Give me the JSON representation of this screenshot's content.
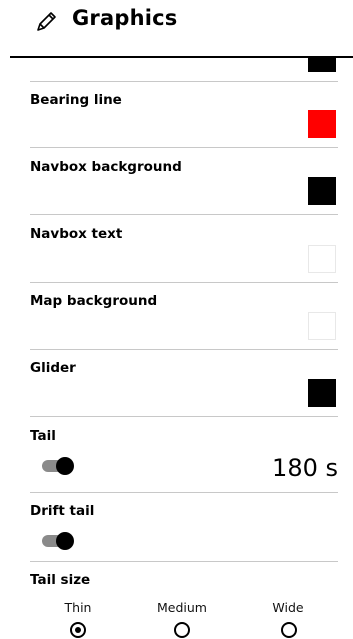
{
  "header": {
    "title": "Graphics",
    "icon": "pencil-icon"
  },
  "settings": {
    "bearing_line": {
      "label": "Bearing line",
      "color": "#ff0000"
    },
    "navbox_background": {
      "label": "Navbox background",
      "color": "#000000"
    },
    "navbox_text": {
      "label": "Navbox text",
      "color": "#ffffff"
    },
    "map_background": {
      "label": "Map background",
      "color": "#ffffff"
    },
    "glider": {
      "label": "Glider",
      "color": "#000000"
    },
    "tail": {
      "label": "Tail",
      "enabled": true,
      "value": "180 s"
    },
    "drift_tail": {
      "label": "Drift tail",
      "enabled": true
    },
    "tail_size": {
      "label": "Tail size",
      "options": [
        "Thin",
        "Medium",
        "Wide"
      ],
      "selected": "Thin"
    }
  },
  "partial_row": {
    "color": "#000000"
  }
}
